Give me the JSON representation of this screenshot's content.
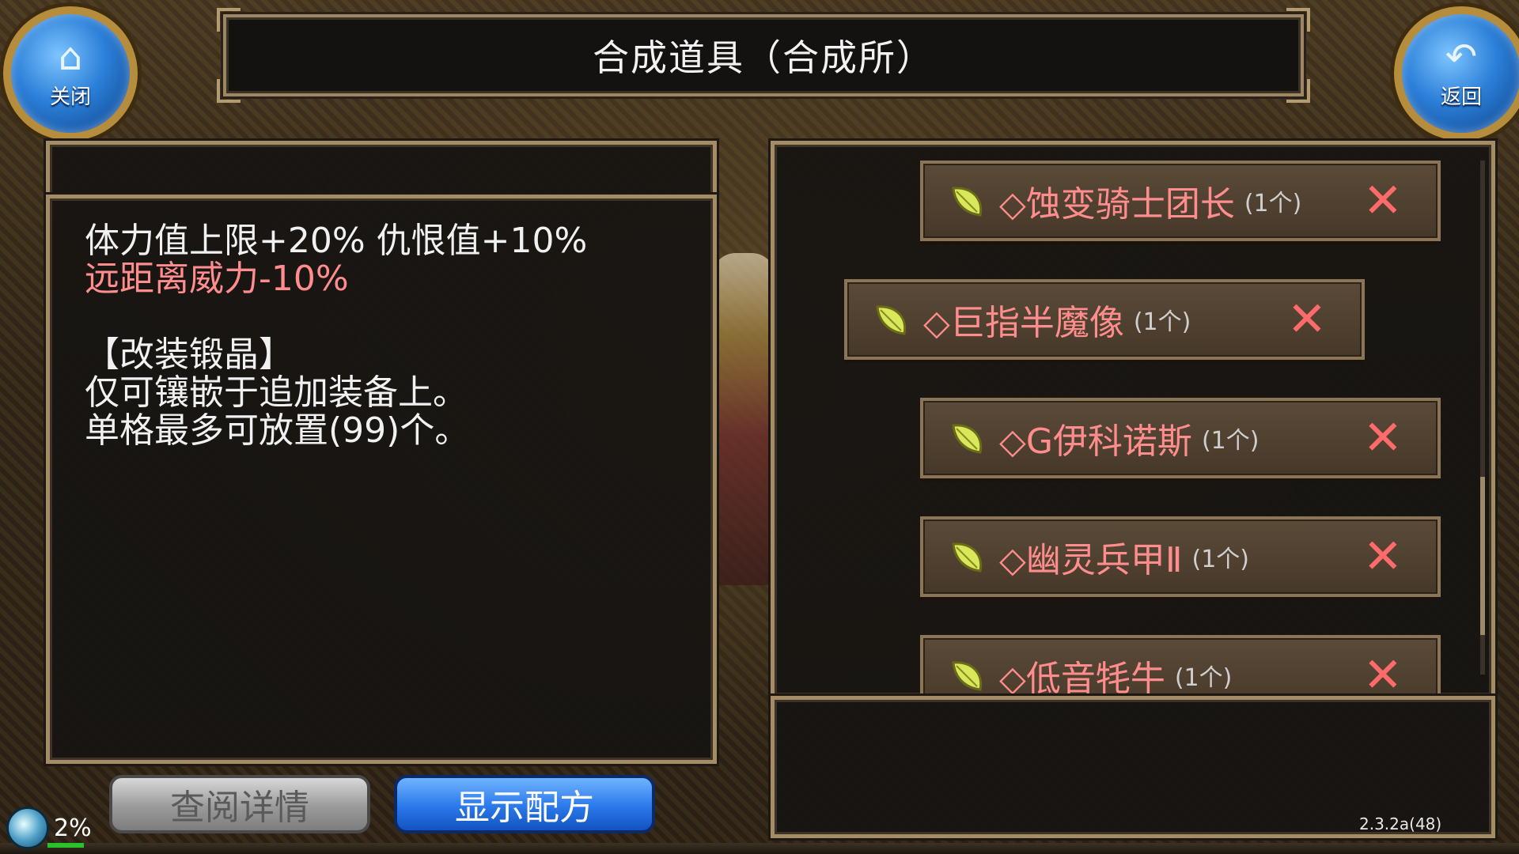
{
  "title": "合成道具（合成所）",
  "nav": {
    "close_label": "关闭",
    "back_label": "返回",
    "close_icon": "home-icon",
    "back_icon": "undo-arrow-icon"
  },
  "description": {
    "line1": "体力值上限+20% 仇恨值+10%",
    "line2": "远距离威力-10%",
    "line3": "【改装锻晶】",
    "line4": "仅可镶嵌于追加装备上。",
    "line5": "单格最多可放置(99)个。"
  },
  "items": [
    {
      "name": "◇蚀变骑士团长",
      "qty": "(1个)"
    },
    {
      "name": "◇巨指半魔像",
      "qty": "(1个)"
    },
    {
      "name": "◇G伊科诺斯",
      "qty": "(1个)"
    },
    {
      "name": "◇幽灵兵甲Ⅱ",
      "qty": "(1个)"
    },
    {
      "name": "◇低音牦牛",
      "qty": "(1个)"
    }
  ],
  "buttons": {
    "view_details": "查阅详情",
    "show_recipe": "显示配方"
  },
  "status": {
    "percent": "2%",
    "version": "2.3.2a(48)"
  },
  "colors": {
    "accent_blue": "#2a78ea",
    "item_name_red": "#ff8d8d",
    "remove_red": "#ff6a6a",
    "frame_gold": "#a38c66"
  }
}
